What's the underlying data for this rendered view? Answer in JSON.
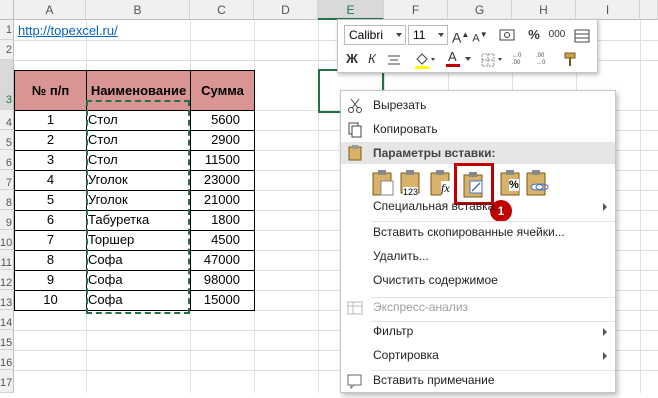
{
  "columns": [
    "A",
    "B",
    "C",
    "D",
    "E",
    "F",
    "G",
    "H",
    "I"
  ],
  "rows": [
    "1",
    "2",
    "3",
    "4",
    "5",
    "6",
    "7",
    "8",
    "9",
    "10",
    "11",
    "12",
    "13",
    "14",
    "15",
    "16",
    "17"
  ],
  "link": "http://topexcel.ru/",
  "table": {
    "headers": [
      "№ п/п",
      "Наименование",
      "Сумма"
    ],
    "rows": [
      {
        "n": "1",
        "name": "Стол",
        "sum": "5600"
      },
      {
        "n": "2",
        "name": "Стол",
        "sum": "2900"
      },
      {
        "n": "3",
        "name": "Стол",
        "sum": "11500"
      },
      {
        "n": "4",
        "name": "Уголок",
        "sum": "23000"
      },
      {
        "n": "5",
        "name": "Уголок",
        "sum": "21000"
      },
      {
        "n": "6",
        "name": "Табуретка",
        "sum": "1800"
      },
      {
        "n": "7",
        "name": "Торшер",
        "sum": "4500"
      },
      {
        "n": "8",
        "name": "Софа",
        "sum": "47000"
      },
      {
        "n": "9",
        "name": "Софа",
        "sum": "98000"
      },
      {
        "n": "10",
        "name": "Софа",
        "sum": "15000"
      }
    ]
  },
  "mini_toolbar": {
    "font": "Calibri",
    "size": "11",
    "grow_font": "A",
    "shrink_font": "A",
    "percent": "%",
    "thousands": "000",
    "bold": "Ж",
    "italic": "К",
    "font_color_letter": "A"
  },
  "context_menu": {
    "cut": "Вырезать",
    "copy": "Копировать",
    "paste_options_header": "Параметры вставки:",
    "paste_special": "Специальная вставка...",
    "insert_copied": "Вставить скопированные ячейки...",
    "delete": "Удалить...",
    "clear": "Очистить содержимое",
    "quick_analysis": "Экспресс-анализ",
    "filter": "Фильтр",
    "sort": "Сортировка",
    "insert_comment": "Вставить примечание",
    "paste_values_sub": "123",
    "paste_formula_sub": "fx",
    "paste_format_sub": "%"
  },
  "callout_number": "1",
  "colors": {
    "header_fill": "#d99594",
    "accent": "#217346",
    "callout": "#c00000",
    "link": "#0563c1"
  }
}
